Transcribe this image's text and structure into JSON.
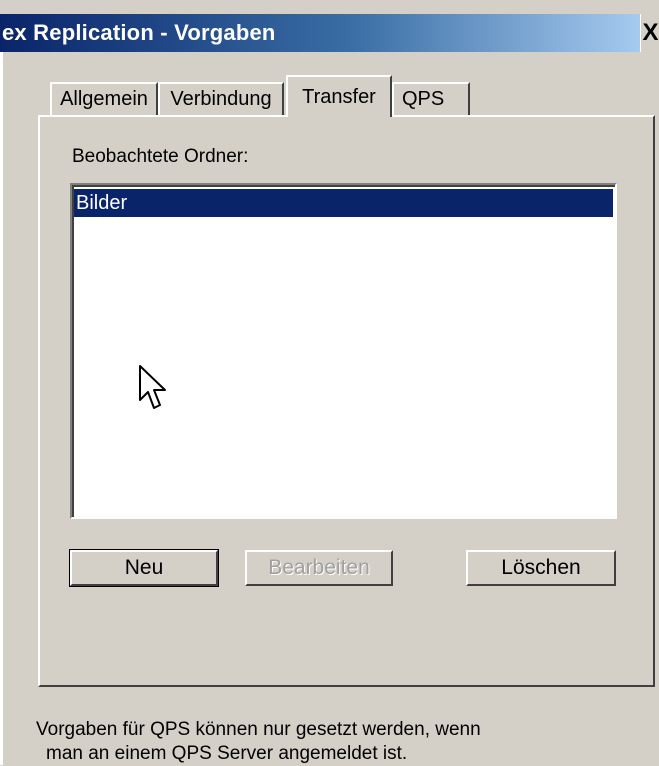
{
  "window": {
    "title": "ex Replication - Vorgaben",
    "close_glyph": "X"
  },
  "tabs": [
    {
      "label": "Allgemein",
      "active": false
    },
    {
      "label": "Verbindung",
      "active": false
    },
    {
      "label": "Transfer",
      "active": true
    },
    {
      "label": "QPS",
      "active": false
    }
  ],
  "transfer": {
    "folders_label": "Beobachtete Ordner:",
    "folders": [
      {
        "name": "Bilder",
        "selected": true
      }
    ],
    "buttons": {
      "new": "Neu",
      "edit": "Bearbeiten",
      "delete": "Löschen"
    }
  },
  "footer": {
    "line1": "Vorgaben für QPS können nur gesetzt werden, wenn",
    "line2": "man an einem QPS Server angemeldet ist."
  },
  "colors": {
    "title_bar": "#0a246a",
    "selection": "#0a246a",
    "face": "#d4d0c8"
  },
  "icons": {
    "close": "close-icon",
    "cursor": "mouse-pointer-icon"
  }
}
